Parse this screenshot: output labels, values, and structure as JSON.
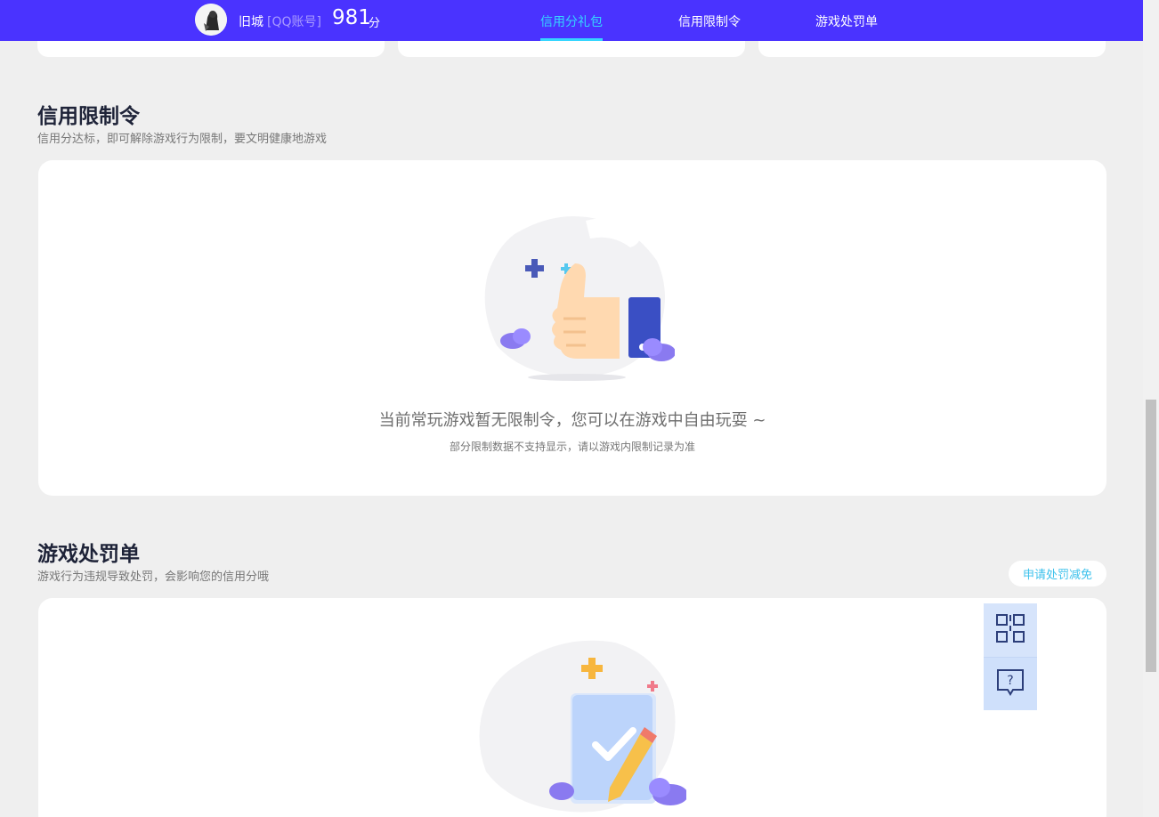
{
  "header": {
    "user_name": "旧城",
    "account_type": "[QQ账号]",
    "score": "981",
    "score_unit": "分",
    "nav": [
      {
        "label": "信用分礼包",
        "active": true
      },
      {
        "label": "信用限制令",
        "active": false
      },
      {
        "label": "游戏处罚单",
        "active": false
      }
    ]
  },
  "restriction": {
    "title": "信用限制令",
    "desc": "信用分达标，即可解除游戏行为限制，要文明健康地游戏",
    "empty_text": "当前常玩游戏暂无限制令，您可以在游戏中自由玩耍 ~",
    "empty_note": "部分限制数据不支持显示，请以游戏内限制记录为准"
  },
  "penalty": {
    "title": "游戏处罚单",
    "desc": "游戏行为违规导致处罚，会影响您的信用分哦",
    "apply_button": "申请处罚减免"
  },
  "float_widget": {
    "qr_icon": "qr-code-icon",
    "help_icon": "help-chat-icon"
  },
  "colors": {
    "header_bg": "#4a33ff",
    "accent": "#35d6ff",
    "link": "#3ec2ec",
    "page_bg": "#efefef"
  }
}
